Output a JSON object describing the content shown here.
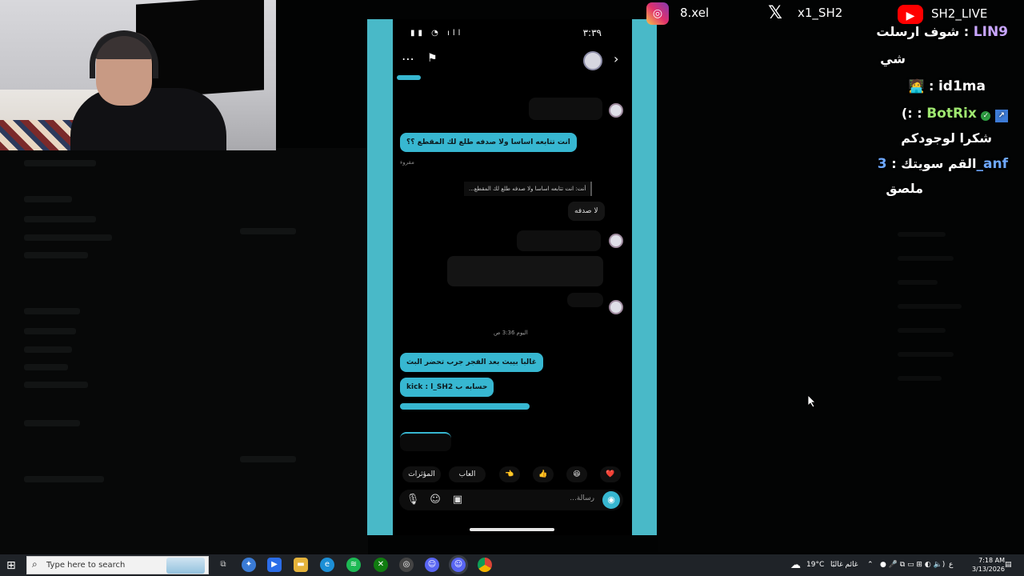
{
  "social": {
    "instagram": {
      "icon": "instagram-icon",
      "handle": "8.xel"
    },
    "x": {
      "icon": "x-icon",
      "handle": "x1_SH2"
    },
    "youtube": {
      "icon": "youtube-icon",
      "handle": "SH2_LIVE"
    }
  },
  "stream_chat": [
    {
      "user": "LIN9",
      "sep": " : ",
      "message": "شوف ارسلت",
      "continuation": "شي",
      "user_color": "#c9a6ff"
    },
    {
      "user": "id1ma",
      "sep": " : ",
      "message": "🧑‍💻",
      "user_color": "#ffffff"
    },
    {
      "user": "BotRix",
      "sep": " : ",
      "message": "(:",
      "continuation": "شكرا لوجودكم",
      "user_color": "#9fe870"
    },
    {
      "user": "3_anf",
      "sep": " : ",
      "message": "القم سويتك",
      "continuation": "ملصق",
      "user_color": "#6ea8ff"
    }
  ],
  "phone": {
    "status_time": "٣:٣٩",
    "messages": {
      "m1": "انت تتابعه اساسا ولا صدفه طلع لك المقطع ؟؟",
      "m1_meta": "مقروء",
      "reply_quote": "أنت: انت تتابعه اساسا ولا صدفه طلع لك المقطع...",
      "m2": "لا صدفه",
      "day_divider": "اليوم 3:36 ص",
      "m3": "غالبا بيبث بعد الفجر جرب تحضر البث",
      "m4": "kick : l_SH2 حسابه ب"
    },
    "reactions": {
      "heart": "❤️",
      "laugh": "😆",
      "thumbs": "👍",
      "point": "👈",
      "games": "العاب",
      "effects": "المؤثرات"
    },
    "composer_placeholder": "رسالة..."
  },
  "taskbar": {
    "search_placeholder": "Type here to search",
    "weather": "19°C",
    "weather_desc": "غائم غالبًا",
    "lang": "ع",
    "time": "7:18 AM",
    "date": "3/13/2026"
  }
}
